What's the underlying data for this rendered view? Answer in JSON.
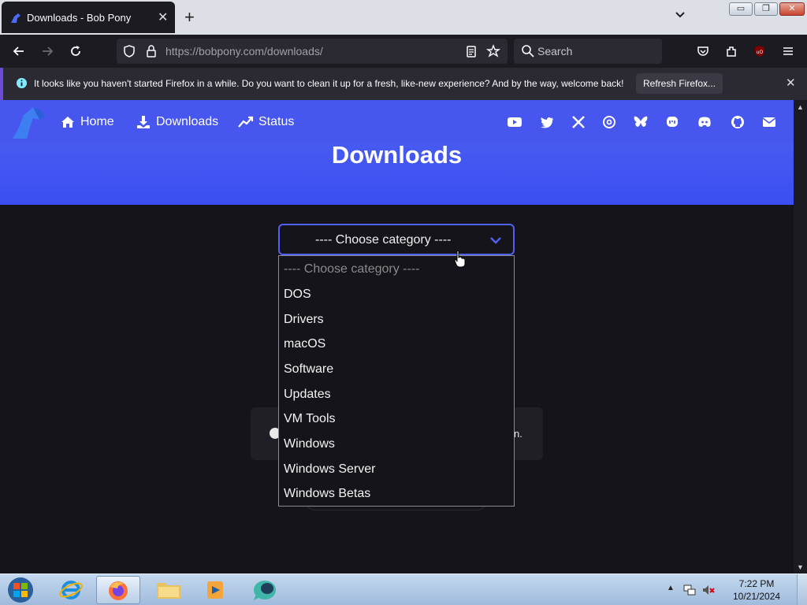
{
  "browser": {
    "tab_title": "Downloads - Bob Pony",
    "tab_close": "✕",
    "new_tab": "+",
    "url_host": "https://bobpony.com",
    "url_path": "/downloads/",
    "search_placeholder": "Search"
  },
  "window_controls": {
    "minimize": "▭",
    "restore": "❐",
    "close": "✕"
  },
  "notification": {
    "message": "It looks like you haven't started Firefox in a while. Do you want to clean it up for a fresh, like-new experience? And by the way, welcome back!",
    "button": "Refresh Firefox...",
    "close": "✕"
  },
  "site": {
    "nav": [
      {
        "label": "Home",
        "icon": "home-icon"
      },
      {
        "label": "Downloads",
        "icon": "download-icon"
      },
      {
        "label": "Status",
        "icon": "trend-icon"
      }
    ],
    "social_icons": [
      "youtube-icon",
      "twitter-icon",
      "x-icon",
      "threads-icon",
      "bluesky-icon",
      "mastodon-icon",
      "discord-icon",
      "github-icon",
      "email-icon"
    ],
    "title": "Downloads",
    "select_value": "---- Choose category ----",
    "options": [
      "---- Choose category ----",
      "DOS",
      "Drivers",
      "macOS",
      "Software",
      "Updates",
      "VM Tools",
      "Windows",
      "Windows Server",
      "Windows Betas"
    ],
    "info_tail": "n."
  },
  "scrollbar": {
    "up": "▲",
    "down": "▼"
  },
  "taskbar": {
    "apps": [
      "internet-explorer-icon",
      "firefox-icon",
      "file-explorer-icon",
      "media-player-icon",
      "chat-app-icon"
    ],
    "tray_arrow": "▲",
    "time": "7:22 PM",
    "date": "10/21/2024"
  },
  "colors": {
    "accent": "#4f63f0",
    "hero": "#3b4ef2",
    "page_bg": "#15141a",
    "toolbar_bg": "#1c1b22"
  }
}
